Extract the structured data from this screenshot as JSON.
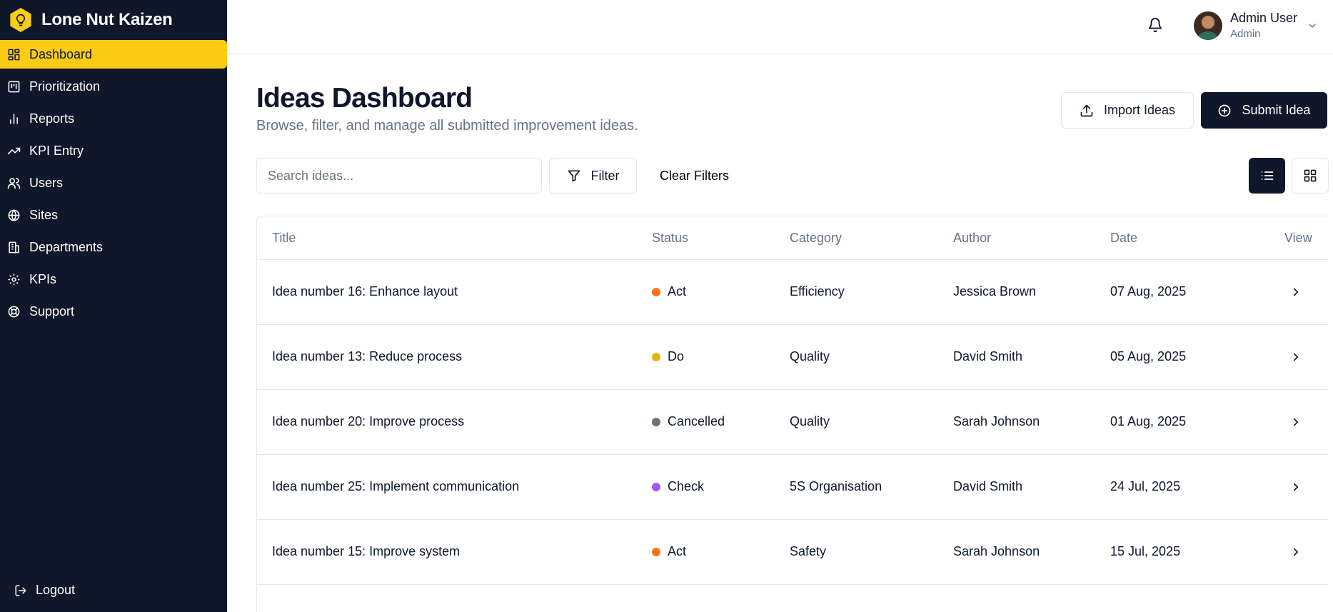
{
  "app": {
    "name": "Lone Nut Kaizen"
  },
  "sidebar": {
    "items": [
      {
        "label": "Dashboard",
        "icon": "dashboard-icon",
        "active": true
      },
      {
        "label": "Prioritization",
        "icon": "kanban-icon",
        "active": false
      },
      {
        "label": "Reports",
        "icon": "bar-chart-icon",
        "active": false
      },
      {
        "label": "KPI Entry",
        "icon": "trending-up-icon",
        "active": false
      },
      {
        "label": "Users",
        "icon": "users-icon",
        "active": false
      },
      {
        "label": "Sites",
        "icon": "globe-icon",
        "active": false
      },
      {
        "label": "Departments",
        "icon": "building-icon",
        "active": false
      },
      {
        "label": "KPIs",
        "icon": "gear-icon",
        "active": false
      },
      {
        "label": "Support",
        "icon": "lifebuoy-icon",
        "active": false
      }
    ],
    "logout_label": "Logout"
  },
  "header": {
    "user": {
      "name": "Admin User",
      "role": "Admin"
    }
  },
  "page": {
    "title": "Ideas Dashboard",
    "subtitle": "Browse, filter, and manage all submitted improvement ideas.",
    "import_label": "Import Ideas",
    "submit_label": "Submit Idea"
  },
  "toolbar": {
    "search_placeholder": "Search ideas...",
    "filter_label": "Filter",
    "clear_label": "Clear Filters"
  },
  "table": {
    "columns": [
      "Title",
      "Status",
      "Category",
      "Author",
      "Date",
      "View"
    ],
    "rows": [
      {
        "title": "Idea number 16: Enhance layout",
        "status": "Act",
        "status_color": "#f97316",
        "category": "Efficiency",
        "author": "Jessica Brown",
        "date": "07 Aug, 2025"
      },
      {
        "title": "Idea number 13: Reduce process",
        "status": "Do",
        "status_color": "#eab308",
        "category": "Quality",
        "author": "David Smith",
        "date": "05 Aug, 2025"
      },
      {
        "title": "Idea number 20: Improve process",
        "status": "Cancelled",
        "status_color": "#6b7280",
        "category": "Quality",
        "author": "Sarah Johnson",
        "date": "01 Aug, 2025"
      },
      {
        "title": "Idea number 25: Implement communication",
        "status": "Check",
        "status_color": "#a855f7",
        "category": "5S Organisation",
        "author": "David Smith",
        "date": "24 Jul, 2025"
      },
      {
        "title": "Idea number 15: Improve system",
        "status": "Act",
        "status_color": "#f97316",
        "category": "Safety",
        "author": "Sarah Johnson",
        "date": "15 Jul, 2025"
      }
    ]
  },
  "colors": {
    "sidebar_bg": "#0f172a",
    "accent": "#facc15",
    "primary_button": "#0f172a"
  }
}
